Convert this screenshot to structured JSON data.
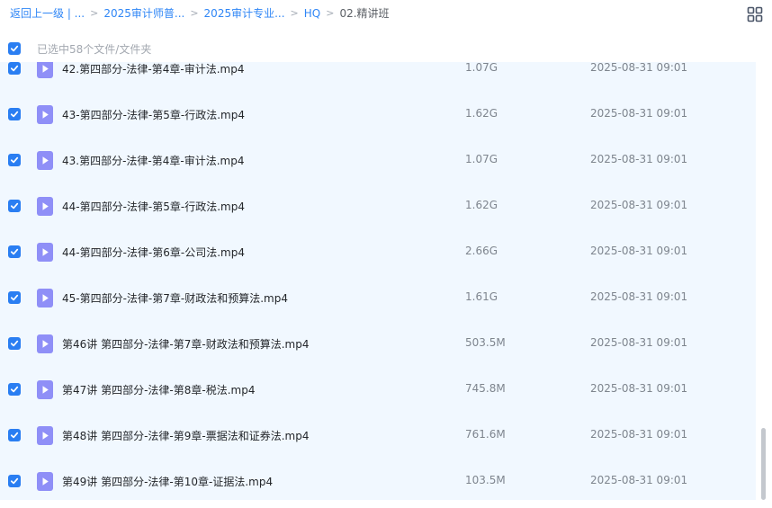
{
  "breadcrumb": {
    "items": [
      "返回上一级 | ...",
      "2025审计师普...",
      "2025审计专业...",
      "HQ"
    ],
    "current": "02.精讲班",
    "separator": ">"
  },
  "view_toggle": {
    "icon": "grid-view-icon"
  },
  "selection": {
    "text": "已选中58个文件/文件夹",
    "checked": true
  },
  "colors": {
    "accent": "#2a7ef2",
    "link": "#2f86f6",
    "list_bg": "#f1f8ff",
    "video_icon": "#8f8ff7"
  },
  "files": [
    {
      "name": "42.第四部分-法律-第4章-审计法.mp4",
      "size": "1.07G",
      "date": "2025-08-31 09:01",
      "checked": true
    },
    {
      "name": "43-第四部分-法律-第5章-行政法.mp4",
      "size": "1.62G",
      "date": "2025-08-31 09:01",
      "checked": true
    },
    {
      "name": "43.第四部分-法律-第4章-审计法.mp4",
      "size": "1.07G",
      "date": "2025-08-31 09:01",
      "checked": true
    },
    {
      "name": "44-第四部分-法律-第5章-行政法.mp4",
      "size": "1.62G",
      "date": "2025-08-31 09:01",
      "checked": true
    },
    {
      "name": "44-第四部分-法律-第6章-公司法.mp4",
      "size": "2.66G",
      "date": "2025-08-31 09:01",
      "checked": true
    },
    {
      "name": "45-第四部分-法律-第7章-财政法和预算法.mp4",
      "size": "1.61G",
      "date": "2025-08-31 09:01",
      "checked": true
    },
    {
      "name": "第46讲 第四部分-法律-第7章-财政法和预算法.mp4",
      "size": "503.5M",
      "date": "2025-08-31 09:01",
      "checked": true
    },
    {
      "name": "第47讲 第四部分-法律-第8章-税法.mp4",
      "size": "745.8M",
      "date": "2025-08-31 09:01",
      "checked": true
    },
    {
      "name": "第48讲 第四部分-法律-第9章-票据法和证券法.mp4",
      "size": "761.6M",
      "date": "2025-08-31 09:01",
      "checked": true
    },
    {
      "name": "第49讲 第四部分-法律-第10章-证据法.mp4",
      "size": "103.5M",
      "date": "2025-08-31 09:01",
      "checked": true
    }
  ]
}
